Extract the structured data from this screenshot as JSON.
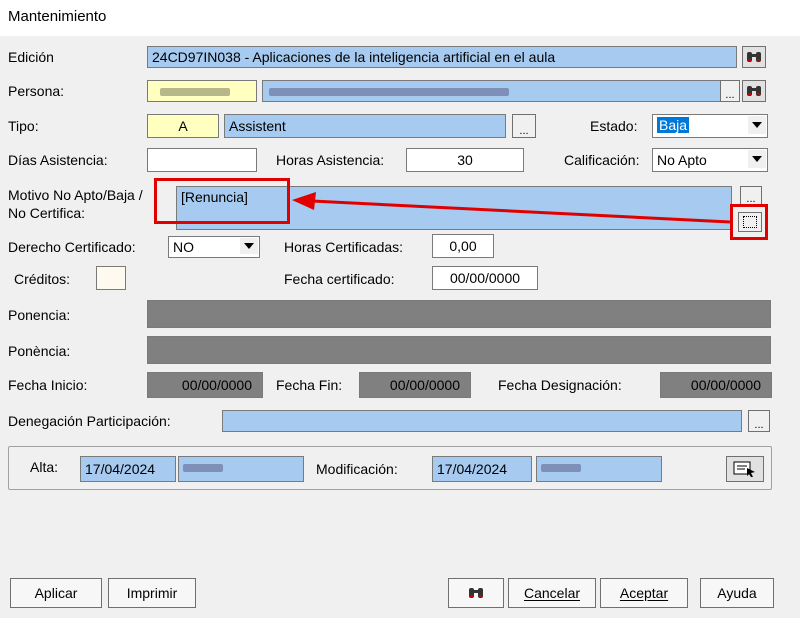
{
  "window": {
    "title": "Mantenimiento"
  },
  "form": {
    "edicion_label": "Edición",
    "edicion_value": "24CD97IN038 - Aplicaciones de la inteligencia artificial en el aula",
    "persona_label": "Persona:",
    "tipo_label": "Tipo:",
    "tipo_code": "A",
    "tipo_value": "Assistent",
    "estado_label": "Estado:",
    "estado_value": "Baja",
    "dias_asistencia_label": "Días Asistencia:",
    "dias_asistencia_value": "",
    "horas_asistencia_label": "Horas Asistencia:",
    "horas_asistencia_value": "30",
    "calificacion_label": "Calificación:",
    "calificacion_value": "No Apto",
    "motivo_label_1": "Motivo No Apto/Baja /",
    "motivo_label_2": "No Certifica:",
    "motivo_value": "[Renuncia]",
    "derecho_label": "Derecho Certificado:",
    "derecho_value": "NO",
    "horas_cert_label": "Horas Certificadas:",
    "horas_cert_value": "0,00",
    "creditos_label": "Créditos:",
    "creditos_value": "",
    "fecha_cert_label": "Fecha certificado:",
    "fecha_cert_value": "00/00/0000",
    "ponencia_es_label": "Ponencia:",
    "ponencia_ca_label": "Ponència:",
    "fecha_inicio_label": "Fecha Inicio:",
    "fecha_inicio_value": "00/00/0000",
    "fecha_fin_label": "Fecha Fin:",
    "fecha_fin_value": "00/00/0000",
    "fecha_designacion_label": "Fecha Designación:",
    "fecha_designacion_value": "00/00/0000",
    "denegacion_label": "Denegación Participación:",
    "dots_label": "..."
  },
  "audit": {
    "alta_label": "Alta:",
    "alta_date": "17/04/2024",
    "modificacion_label": "Modificación:",
    "modificacion_date": "17/04/2024"
  },
  "buttons": {
    "aplicar": "Aplicar",
    "imprimir": "Imprimir",
    "cancelar": "Cancelar",
    "aceptar": "Aceptar",
    "ayuda": "Ayuda"
  },
  "icons": {
    "lookup": "binoculars-icon",
    "audit": "card-pointer-icon",
    "annotation_arrow_color": "#e00000"
  }
}
